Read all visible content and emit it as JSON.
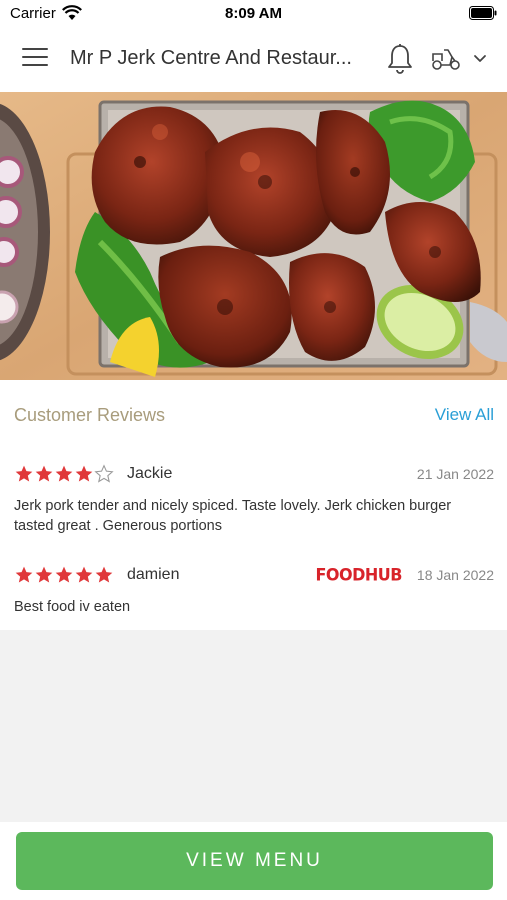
{
  "status_bar": {
    "carrier": "Carrier",
    "time": "8:09 AM"
  },
  "header": {
    "title": "Mr P Jerk Centre And Restaur..."
  },
  "reviews": {
    "heading": "Customer Reviews",
    "view_all": "View All",
    "items": [
      {
        "name": "Jackie",
        "rating": 4,
        "max_rating": 5,
        "date": "21 Jan 2022",
        "text": "Jerk pork tender and nicely spiced. Taste lovely. Jerk chicken burger tasted great . Generous portions",
        "source": ""
      },
      {
        "name": "damien",
        "rating": 5,
        "max_rating": 5,
        "date": "18 Jan 2022",
        "text": "Best food iv eaten",
        "source": "FOODHUB"
      }
    ]
  },
  "footer": {
    "view_menu": "VIEW MENU"
  },
  "colors": {
    "accent_green": "#5cb85c",
    "link_blue": "#2a9fd6",
    "star_red": "#e0383a",
    "heading_tan": "#a89c7c",
    "foodhub_red": "#d8232a"
  },
  "icons": [
    "menu-icon",
    "bell-icon",
    "scooter-icon",
    "chevron-down-icon",
    "star-icon",
    "wifi-icon",
    "battery-icon"
  ]
}
